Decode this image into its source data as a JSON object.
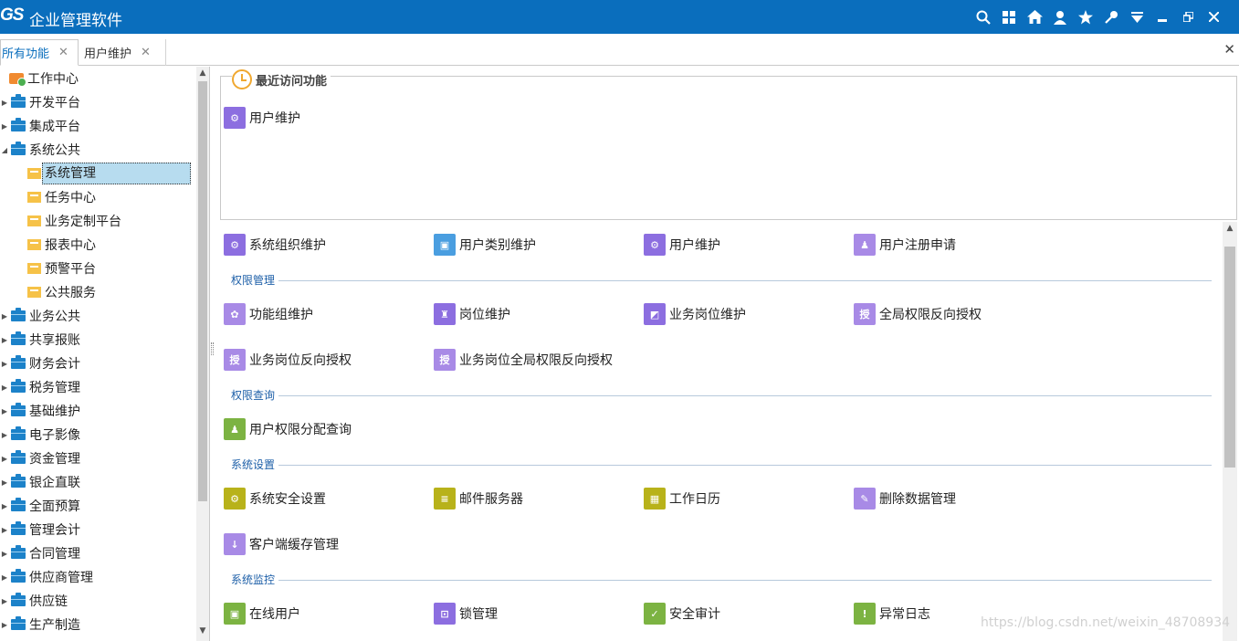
{
  "app": {
    "logo": "GS",
    "title": "企业管理软件"
  },
  "titlebar_icons": [
    "search-icon",
    "grid-icon",
    "home-icon",
    "user-icon",
    "star-icon",
    "key-icon",
    "dropdown-icon",
    "minimize-icon",
    "restore-icon",
    "close-icon"
  ],
  "tabs": [
    {
      "label": "所有功能",
      "close": "✕"
    },
    {
      "label": "用户维护",
      "close": "✕"
    }
  ],
  "close_all": "✕",
  "tree": {
    "work_center": "工作中心",
    "top": [
      "开发平台",
      "集成平台",
      "系统公共"
    ],
    "children": [
      "系统管理",
      "任务中心",
      "业务定制平台",
      "报表中心",
      "预警平台",
      "公共服务"
    ],
    "rest": [
      "业务公共",
      "共享报账",
      "财务会计",
      "税务管理",
      "基础维护",
      "电子影像",
      "资金管理",
      "银企直联",
      "全面预算",
      "管理会计",
      "合同管理",
      "供应商管理",
      "供应链",
      "生产制造"
    ]
  },
  "recent": {
    "title": "最近访问功能",
    "items": [
      "用户维护"
    ]
  },
  "org_items": [
    "系统组织维护",
    "用户类别维护",
    "用户维护",
    "用户注册申请"
  ],
  "sections": {
    "perm_mgmt": {
      "title": "权限管理",
      "items": [
        "功能组维护",
        "岗位维护",
        "业务岗位维护",
        "全局权限反向授权",
        "业务岗位反向授权",
        "业务岗位全局权限反向授权"
      ]
    },
    "perm_query": {
      "title": "权限查询",
      "items": [
        "用户权限分配查询"
      ]
    },
    "sys_settings": {
      "title": "系统设置",
      "items": [
        "系统安全设置",
        "邮件服务器",
        "工作日历",
        "删除数据管理",
        "客户端缓存管理"
      ]
    },
    "sys_monitor": {
      "title": "系统监控",
      "items": [
        "在线用户",
        "锁管理",
        "安全审计",
        "异常日志"
      ]
    }
  },
  "watermark": "https://blog.csdn.net/weixin_48708934"
}
